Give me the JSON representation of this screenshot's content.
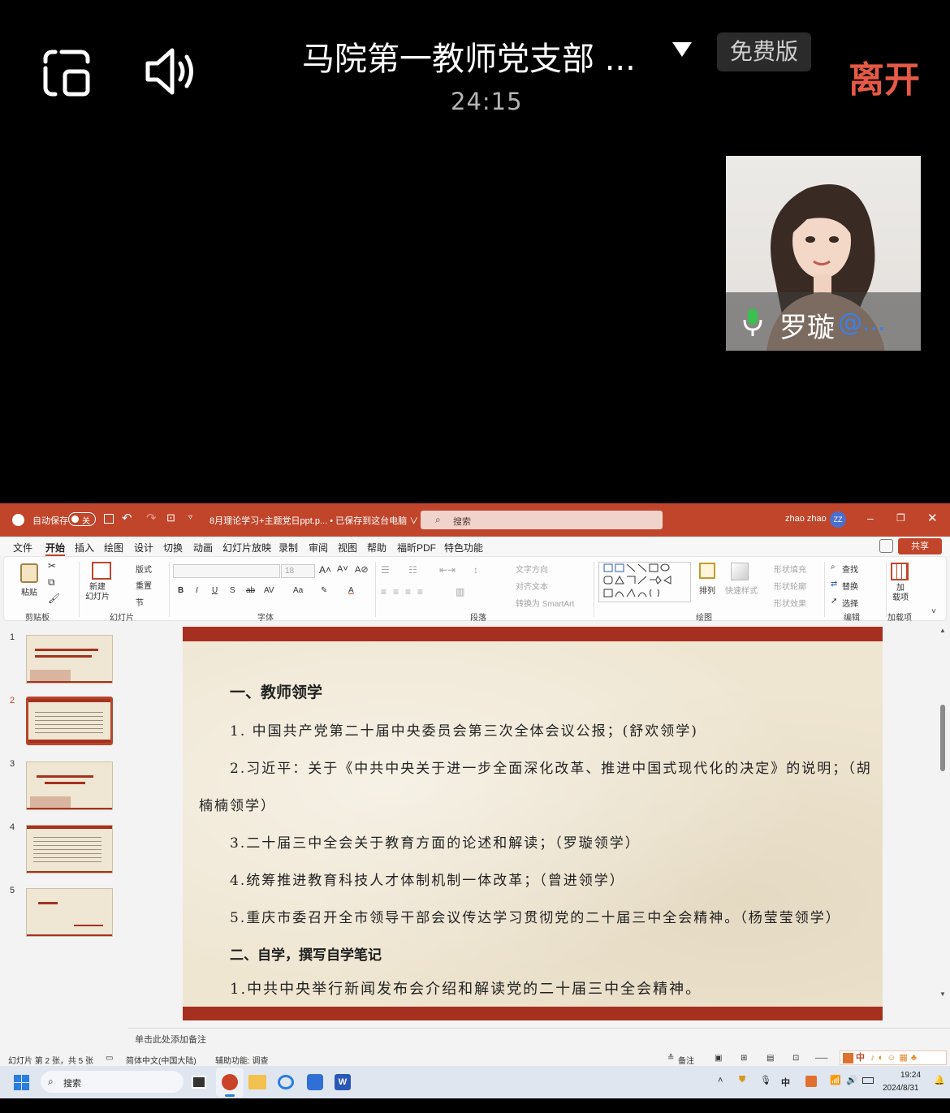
{
  "meeting": {
    "title": "马院第一教师党支部 ...",
    "timer": "24:15",
    "free_badge": "免费版",
    "leave_label": "离开",
    "participant": {
      "name": "罗璇",
      "at_suffix": "@..."
    }
  },
  "ppt": {
    "autosave_label": "自动保存",
    "autosave_toggle": "关",
    "file_title": "8月理论学习+主题党日ppt.p... • 已保存到这台电脑 ∨",
    "search_placeholder": "搜索",
    "user_name": "zhao zhao",
    "user_initials": "ZZ",
    "share_label": "共享",
    "menu": [
      "文件",
      "开始",
      "插入",
      "绘图",
      "设计",
      "切换",
      "动画",
      "幻灯片放映",
      "录制",
      "审阅",
      "视图",
      "帮助",
      "福昕PDF",
      "特色功能"
    ],
    "ribbon": {
      "paste": "粘贴",
      "clipboard_group": "剪贴板",
      "new_slide": "新建\n幻灯片",
      "layout": "版式",
      "reset": "重置",
      "section": "节",
      "slides_group": "幻灯片",
      "font_size": "18",
      "font_group": "字体",
      "text_direction": "文字方向",
      "align_text": "对齐文本",
      "smartart": "转换为 SmartArt",
      "paragraph_group": "段落",
      "arrange": "排列",
      "quick_styles": "快速样式",
      "shape_fill": "形状填充",
      "shape_outline": "形状轮廓",
      "shape_effects": "形状效果",
      "drawing_group": "绘图",
      "find": "查找",
      "replace": "替换",
      "select": "选择",
      "editing_group": "编辑",
      "addins": "加\n载项",
      "addins_group": "加载项"
    },
    "thumbnails": [
      "1",
      "2",
      "3",
      "4",
      "5"
    ],
    "slide": {
      "heading1": "一、教师领学",
      "lines": [
        "1. 中国共产党第二十届中央委员会第三次全体会议公报；(舒欢领学)",
        "2.习近平：关于《中共中央关于进一步全面深化改革、推进中国式现代化的决定》的说明；（胡",
        "楠楠领学）",
        "3.二十届三中全会关于教育方面的论述和解读；（罗璇领学）",
        "4.统筹推进教育科技人才体制机制一体改革；（曾进领学）",
        "5.重庆市委召开全市领导干部会议传达学习贯彻党的二十届三中全会精神。（杨莹莹领学）"
      ],
      "heading2": "二、自学，撰写自学笔记",
      "line_after": "1.中共中央举行新闻发布会介绍和解读党的二十届三中全会精神。"
    },
    "notes_placeholder": "单击此处添加备注",
    "status": {
      "slide_count": "幻灯片 第 2 张，共 5 张",
      "language": "简体中文(中国大陆)",
      "accessibility": "辅助功能: 调查",
      "notes_btn": "备注",
      "ime": "中"
    }
  },
  "taskbar": {
    "search": "搜索",
    "ime": "中",
    "time": "19:24",
    "date": "2024/8/31"
  },
  "colors": {
    "ppt_accent": "#c1452b",
    "leave_red": "#e55a46",
    "slide_band": "#a6301f"
  }
}
